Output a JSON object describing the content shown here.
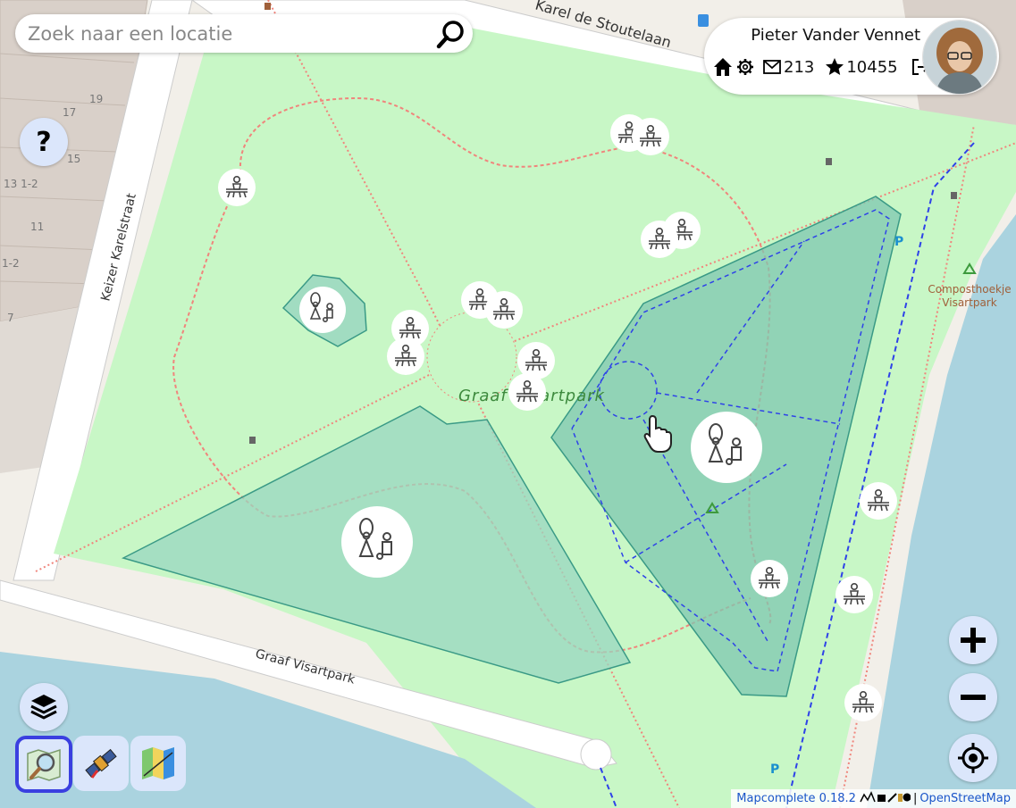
{
  "search": {
    "placeholder": "Zoek naar een locatie"
  },
  "user": {
    "name": "Pieter Vander Vennet",
    "message_count": "213",
    "star_count": "10455"
  },
  "map": {
    "park_label": "Graaf Visartpark",
    "street_labels": {
      "karel_de_stoutelaan": "Karel de Stoutelaan",
      "keizer_karelstraat": "Keizer Karelstraat",
      "graaf_visartpark_street": "Graaf Visartpark"
    },
    "poi_label_line1": "Composthoekje",
    "poi_label_line2": "Visartpark",
    "house_numbers": [
      "19",
      "17",
      "15",
      "13 1-2",
      "11",
      "1-2",
      "7"
    ]
  },
  "attribution": {
    "version_text": "Mapcomplete 0.18.2",
    "separator": "|",
    "osm_link": "OpenStreetMap"
  },
  "controls": {
    "help": "?",
    "zoom_in": "+",
    "zoom_out": "−"
  },
  "colors": {
    "park_fill": "#c8f7c6",
    "playground_fill": "#9ad7c0",
    "playground_stroke": "#3a9a86",
    "footpath": "#f0857c",
    "cycleway": "#2e42e8",
    "water": "#aad3df",
    "accent": "#3a3fe0"
  },
  "icons": {
    "search": "search-icon",
    "help": "question-icon",
    "layers": "layers-icon",
    "home": "home-icon",
    "settings": "gear-icon",
    "mail": "envelope-icon",
    "star": "star-icon",
    "logout": "logout-icon",
    "picnic": "picnic-table-icon",
    "playground": "playground-icon",
    "zoom_in": "plus-icon",
    "zoom_out": "minus-icon",
    "geolocate": "crosshair-icon"
  }
}
